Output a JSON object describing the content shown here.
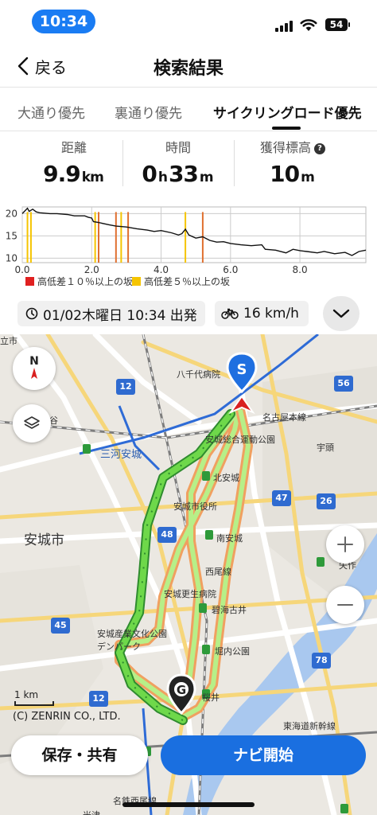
{
  "status_bar": {
    "time": "10:34",
    "battery": "54"
  },
  "header": {
    "back_label": "戻る",
    "title": "検索結果"
  },
  "tabs": [
    {
      "label": "大通り優先",
      "active": false
    },
    {
      "label": "裏通り優先",
      "active": false
    },
    {
      "label": "サイクリングロード優先",
      "active": true
    }
  ],
  "stats": {
    "distance": {
      "label": "距離",
      "value": "9.9",
      "unit": "km"
    },
    "time": {
      "label": "時間",
      "hours": "0",
      "h_unit": "h",
      "minutes": "33",
      "m_unit": "m"
    },
    "elevation": {
      "label": "獲得標高",
      "value": "10",
      "unit": "m",
      "help": "?"
    }
  },
  "chart_data": {
    "type": "line",
    "title": "",
    "xlabel": "",
    "ylabel": "",
    "x_ticks": [
      "0.0",
      "2.0",
      "4.0",
      "6.0",
      "8.0"
    ],
    "y_ticks": [
      "20",
      "15",
      "10"
    ],
    "xlim": [
      0,
      9.9
    ],
    "ylim": [
      9,
      21.5
    ],
    "grid": true,
    "x": [
      0,
      0.15,
      0.2,
      0.3,
      0.4,
      0.5,
      0.8,
      1.0,
      1.3,
      1.5,
      1.8,
      1.9,
      2.0,
      2.05,
      2.2,
      2.5,
      2.7,
      3.0,
      3.3,
      3.6,
      3.8,
      4.0,
      4.3,
      4.5,
      4.6,
      4.7,
      4.8,
      5.0,
      5.2,
      5.4,
      5.6,
      5.8,
      6.0,
      6.3,
      6.6,
      6.9,
      7.0,
      7.3,
      7.6,
      7.8,
      8.0,
      8.2,
      8.5,
      8.7,
      9.0,
      9.3,
      9.5,
      9.7,
      9.9
    ],
    "y": [
      20,
      21.2,
      20.5,
      21,
      20.4,
      20.2,
      20,
      20,
      19.8,
      19.5,
      19.5,
      19.2,
      19,
      18.2,
      18,
      17.5,
      17.2,
      17,
      16.6,
      16.3,
      16,
      16.2,
      15.7,
      15.2,
      15.5,
      16.5,
      15.2,
      14.5,
      14.8,
      14,
      13.6,
      13.7,
      13.3,
      13,
      12.8,
      13,
      12,
      11.8,
      11.2,
      12,
      11.7,
      11.5,
      11.2,
      11.5,
      11,
      11.3,
      10.6,
      11.5,
      11.8
    ],
    "legend": [
      {
        "label": "高低差１０％以上の坂",
        "color": "#e02020"
      },
      {
        "label": "高低差５％以上の坂",
        "color": "#f5c400"
      }
    ],
    "steep_markers": [
      {
        "x": 0.15,
        "color": "#f5c400"
      },
      {
        "x": 0.25,
        "color": "#f5c400"
      },
      {
        "x": 2.1,
        "color": "#f5c400"
      },
      {
        "x": 2.2,
        "color": "#e07030"
      },
      {
        "x": 2.7,
        "color": "#e07030"
      },
      {
        "x": 2.85,
        "color": "#f5c400"
      },
      {
        "x": 3.05,
        "color": "#e07030"
      },
      {
        "x": 4.7,
        "color": "#f5c400"
      },
      {
        "x": 5.2,
        "color": "#e07030"
      }
    ]
  },
  "departure": {
    "date_time": "01/02木曜日 10:34 出発",
    "speed": "16 km/h"
  },
  "map": {
    "labels": {
      "city_left_top": "立市",
      "hospital": "八千代病院",
      "nagoya_line": "名古屋本線",
      "sports_park": "安城総合運動公園",
      "utou": "宇頭",
      "mikawa_anjo": "三河安城",
      "kita_anjo": "北安城",
      "city_hall": "安城市役所",
      "minami_anjo": "南安城",
      "anjo_city": "安城市",
      "nishio_line": "西尾線",
      "kousei_hospital": "安城更生病院",
      "hekikai_furui": "碧海古井",
      "culture_park": "安城産業文化公園\nデンパーク",
      "horiuchi_park": "堀内公園",
      "sakurai": "桜井",
      "tokaido_shinkansen": "東海道新幹線",
      "meitetsu_nishio": "名鉄西尾線",
      "yonezu": "米津",
      "left_edge_a": "谷",
      "yatsu": "矢作"
    },
    "shields": [
      "12",
      "56",
      "47",
      "26",
      "48",
      "45",
      "78",
      "12"
    ],
    "start_marker": "S",
    "goal_marker": "G",
    "compass": "N",
    "scale": "1 km",
    "copyright": "(C) ZENRIN CO., LTD."
  },
  "buttons": {
    "save_share": "保存・共有",
    "start_navi": "ナビ開始"
  }
}
